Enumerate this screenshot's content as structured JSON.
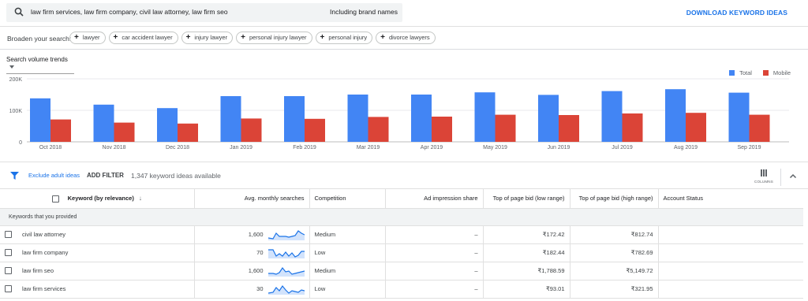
{
  "search": {
    "query": "law firm services, law firm company, civil law attorney, law firm seo",
    "brand_label": "Including brand names"
  },
  "download_label": "DOWNLOAD KEYWORD IDEAS",
  "broaden": {
    "label": "Broaden your search:",
    "chips": [
      "lawyer",
      "car accident lawyer",
      "injury lawyer",
      "personal injury lawyer",
      "personal injury",
      "divorce lawyers"
    ]
  },
  "trend_dropdown": "Search volume trends",
  "legend": [
    {
      "name": "Total",
      "color": "#4285f4"
    },
    {
      "name": "Mobile",
      "color": "#db4437"
    }
  ],
  "chart_data": {
    "type": "bar",
    "categories": [
      "Oct 2018",
      "Nov 2018",
      "Dec 2018",
      "Jan 2019",
      "Feb 2019",
      "Mar 2019",
      "Apr 2019",
      "May 2019",
      "Jun 2019",
      "Jul 2019",
      "Aug 2019",
      "Sep 2019"
    ],
    "series": [
      {
        "name": "Total",
        "color": "#4285f4",
        "values": [
          138000,
          118000,
          107000,
          145000,
          145000,
          150000,
          150000,
          157000,
          149000,
          161000,
          167000,
          156000
        ]
      },
      {
        "name": "Mobile",
        "color": "#db4437",
        "values": [
          71000,
          61000,
          58000,
          74000,
          73000,
          79000,
          80000,
          86000,
          85000,
          90000,
          92000,
          86000
        ]
      }
    ],
    "yticks": [
      "0",
      "100K",
      "200K"
    ],
    "ylim": [
      0,
      200000
    ],
    "grid": true,
    "legend_position": "top-right"
  },
  "filterbar": {
    "exclude_label": "Exclude adult ideas",
    "add_filter_label": "ADD FILTER",
    "count_label": "1,347 keyword ideas available",
    "columns_label": "COLUMNS"
  },
  "table": {
    "headers": {
      "keyword": "Keyword (by relevance)",
      "avg": "Avg. monthly searches",
      "competition": "Competition",
      "ad_share": "Ad impression share",
      "low_bid": "Top of page bid (low range)",
      "high_bid": "Top of page bid (high range)",
      "status": "Account Status"
    },
    "group_label": "Keywords that you provided",
    "rows": [
      {
        "keyword": "civil law attorney",
        "avg": "1,600",
        "competition": "Medium",
        "ad_share": "–",
        "low_bid": "₹172.42",
        "high_bid": "₹812.74",
        "status": ""
      },
      {
        "keyword": "law firm company",
        "avg": "70",
        "competition": "Low",
        "ad_share": "–",
        "low_bid": "₹182.44",
        "high_bid": "₹782.69",
        "status": ""
      },
      {
        "keyword": "law firm seo",
        "avg": "1,600",
        "competition": "Medium",
        "ad_share": "–",
        "low_bid": "₹1,788.59",
        "high_bid": "₹5,149.72",
        "status": ""
      },
      {
        "keyword": "law firm services",
        "avg": "30",
        "competition": "Low",
        "ad_share": "–",
        "low_bid": "₹93.01",
        "high_bid": "₹321.95",
        "status": ""
      }
    ]
  }
}
